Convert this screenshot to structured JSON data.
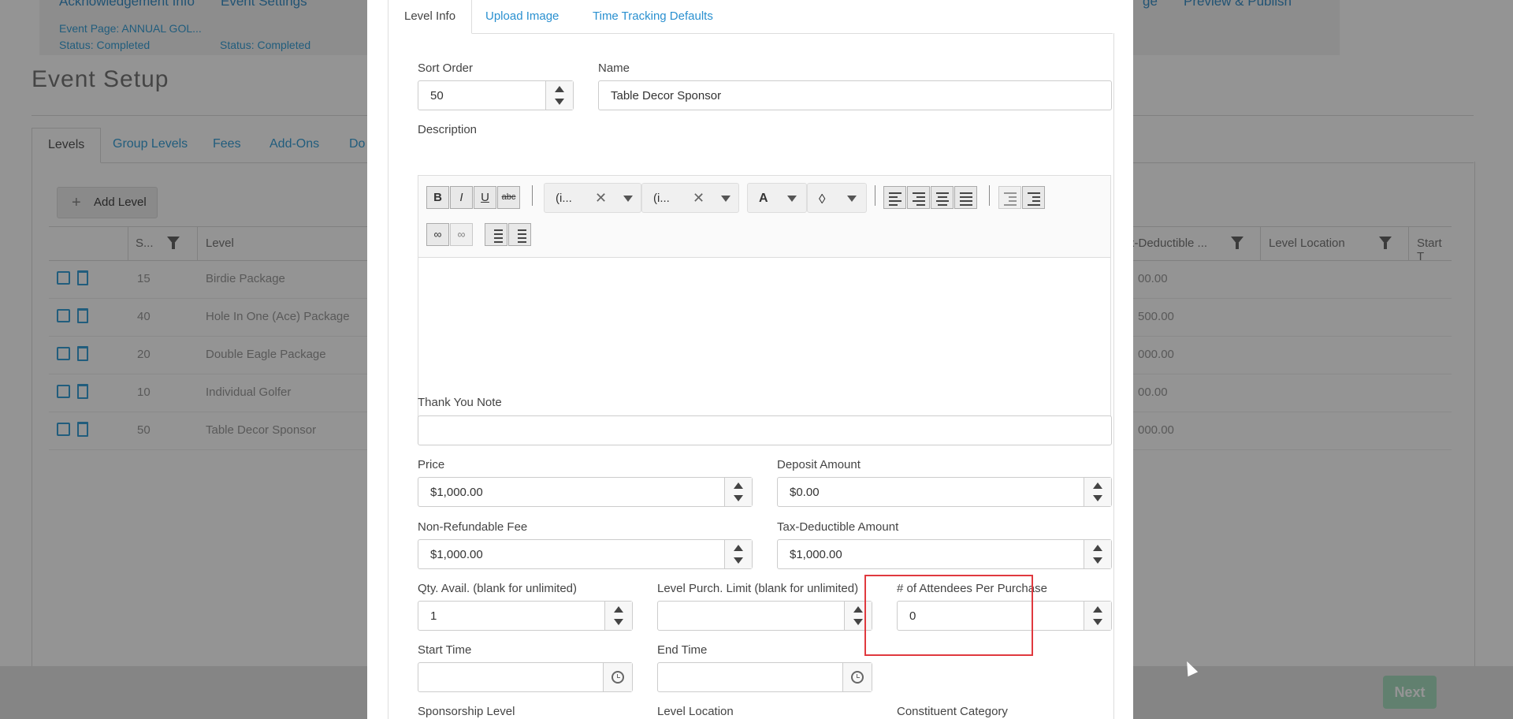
{
  "background": {
    "steps": [
      {
        "title": "Acknowledgement Info",
        "sub": "Event Page: ANNUAL GOL..."
      },
      {
        "title": "Event Settings",
        "sub": "Status: Completed"
      },
      {
        "title": "ge",
        "sub": ""
      },
      {
        "title": "Preview & Publish",
        "sub": ""
      }
    ],
    "status_completed": "Status: Completed",
    "page_title": "Event Setup",
    "tabs": [
      "Levels",
      "Group Levels",
      "Fees",
      "Add-Ons",
      "Do"
    ],
    "add_level_label": "Add Level",
    "add_level_icon": "plus-icon",
    "grid_headers": {
      "sort": "S...",
      "level": "Level",
      "tax": "x-Deductible ...",
      "location": "Level Location",
      "start": "Start T"
    },
    "rows": [
      {
        "sort": "15",
        "level": "Birdie Package",
        "tax": "00.00"
      },
      {
        "sort": "40",
        "level": "Hole In One (Ace) Package",
        "tax": "500.00"
      },
      {
        "sort": "20",
        "level": "Double Eagle Package",
        "tax": "000.00"
      },
      {
        "sort": "10",
        "level": "Individual Golfer",
        "tax": "00.00"
      },
      {
        "sort": "50",
        "level": "Table Decor Sponsor",
        "tax": "000.00"
      }
    ],
    "next_label": "Next"
  },
  "modal": {
    "tabs": {
      "level_info": "Level Info",
      "upload_image": "Upload Image",
      "time_tracking": "Time Tracking Defaults"
    },
    "sort_order": {
      "label": "Sort Order",
      "value": "50"
    },
    "name": {
      "label": "Name",
      "value": "Table Decor Sponsor"
    },
    "description": {
      "label": "Description",
      "toolbar": {
        "bold": "B",
        "italic": "I",
        "underline": "U",
        "strike": "abc",
        "font_name": "(i...",
        "font_size": "(i...",
        "font_color": "A"
      }
    },
    "thank_you_note": {
      "label": "Thank You Note",
      "value": ""
    },
    "price": {
      "label": "Price",
      "value": "$1,000.00"
    },
    "deposit": {
      "label": "Deposit Amount",
      "value": "$0.00"
    },
    "non_refundable": {
      "label": "Non-Refundable Fee",
      "value": "$1,000.00"
    },
    "tax_deductible": {
      "label": "Tax-Deductible Amount",
      "value": "$1,000.00"
    },
    "qty_avail": {
      "label": "Qty. Avail. (blank for unlimited)",
      "value": "1"
    },
    "purch_limit": {
      "label": "Level Purch. Limit (blank for unlimited)",
      "value": ""
    },
    "attendees": {
      "label": "# of Attendees Per Purchase",
      "value": "0"
    },
    "start_time": {
      "label": "Start Time",
      "value": ""
    },
    "end_time": {
      "label": "End Time",
      "value": ""
    },
    "sponsorship_level": {
      "label": "Sponsorship Level"
    },
    "level_location": {
      "label": "Level Location"
    },
    "constituent_category": {
      "label": "Constituent Category"
    }
  },
  "colors": {
    "highlight": "#e0393e",
    "link": "#2a90d0",
    "next_button": "#a7dcc0"
  }
}
